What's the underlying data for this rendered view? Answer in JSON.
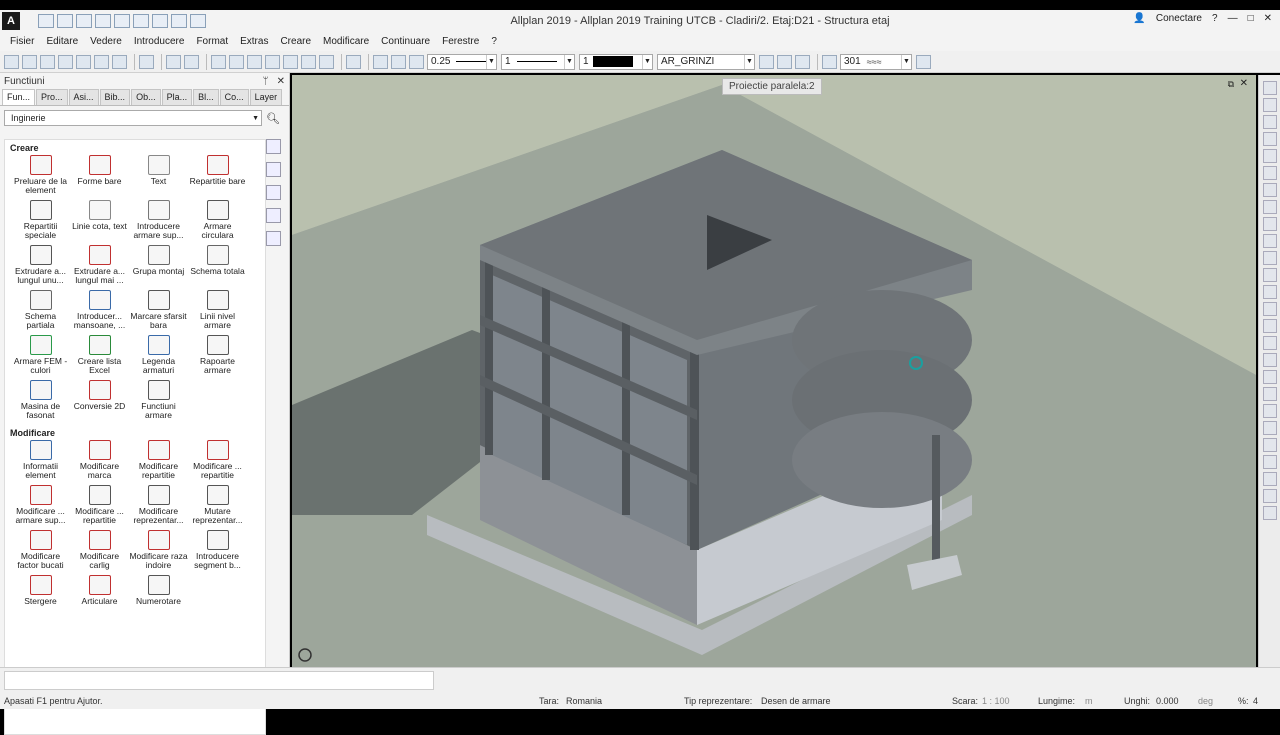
{
  "app": {
    "logo": "A",
    "title": "Allplan 2019 - Allplan 2019 Training UTCB - Cladiri/2. Etaj:D21 - Structura etaj",
    "connect": "Conectare",
    "help": "?",
    "minimize": "—",
    "maximize": "□",
    "close": "✕"
  },
  "menu": [
    "Fisier",
    "Editare",
    "Vedere",
    "Introducere",
    "Format",
    "Extras",
    "Creare",
    "Modificare",
    "Continuare",
    "Ferestre",
    "?"
  ],
  "toolbar": {
    "pen_value": "0.25",
    "line_value": "1",
    "color_value": "1",
    "layer_value": "AR_GRINZI",
    "hatch_value": "301"
  },
  "panel": {
    "title": "Functiuni",
    "pin": "ᛘ",
    "close": "✕",
    "tabs": [
      "Fun...",
      "Pro...",
      "Asi...",
      "Bib...",
      "Ob...",
      "Pla...",
      "Bl...",
      "Co...",
      "Layer"
    ],
    "category": "Inginerie",
    "sections": [
      {
        "title": "Creare",
        "items": [
          {
            "label": "Preluare de la element",
            "icon": "element-icon",
            "color": "#c03030"
          },
          {
            "label": "Forme bare",
            "icon": "rebar-shape-icon",
            "color": "#c03030"
          },
          {
            "label": "Text",
            "icon": "text-icon",
            "color": "#888888"
          },
          {
            "label": "Repartitie bare",
            "icon": "rebar-placement-icon",
            "color": "#c03030"
          },
          {
            "label": "Repartitii speciale",
            "icon": "special-placement-icon",
            "color": "#555555"
          },
          {
            "label": "Linie cota, text",
            "icon": "dimension-line-icon",
            "color": "#888888"
          },
          {
            "label": "Introducere armare sup...",
            "icon": "area-reinf-icon",
            "color": "#777777"
          },
          {
            "label": "Armare circulara",
            "icon": "circular-reinf-icon",
            "color": "#555555"
          },
          {
            "label": "Extrudare a... lungul unu...",
            "icon": "extrude-icon",
            "color": "#555555"
          },
          {
            "label": "Extrudare a... lungul mai ...",
            "icon": "extrude-multi-icon",
            "color": "#c03030"
          },
          {
            "label": "Grupa montaj",
            "icon": "group-icon",
            "color": "#666666"
          },
          {
            "label": "Schema totala",
            "icon": "schema-icon",
            "color": "#666666"
          },
          {
            "label": "Schema partiala",
            "icon": "partial-schema-icon",
            "color": "#666666"
          },
          {
            "label": "Introducer... mansoane, ...",
            "icon": "coupler-icon",
            "color": "#3a6aa8"
          },
          {
            "label": "Marcare sfarsit bara",
            "icon": "bar-end-icon",
            "color": "#555555"
          },
          {
            "label": "Linii nivel armare",
            "icon": "level-lines-icon",
            "color": "#555555"
          },
          {
            "label": "Armare FEM - culori",
            "icon": "fem-colors-icon",
            "color": "#2a9a4a"
          },
          {
            "label": "Creare lista Excel",
            "icon": "excel-icon",
            "color": "#2a8a3a"
          },
          {
            "label": "Legenda armaturi",
            "icon": "legend-icon",
            "color": "#3a6aa8"
          },
          {
            "label": "Rapoarte armare",
            "icon": "reports-icon",
            "color": "#555555"
          },
          {
            "label": "Masina de fasonat",
            "icon": "bending-machine-icon",
            "color": "#3a6aa8"
          },
          {
            "label": "Conversie 2D",
            "icon": "convert-2d-icon",
            "color": "#c03030"
          },
          {
            "label": "Functiuni armare",
            "icon": "reinf-functions-icon",
            "color": "#555555"
          }
        ]
      },
      {
        "title": "Modificare",
        "items": [
          {
            "label": "Informatii element",
            "icon": "info-icon",
            "color": "#3a6aa8"
          },
          {
            "label": "Modificare marca",
            "icon": "modify-mark-icon",
            "color": "#c03030"
          },
          {
            "label": "Modificare repartitie",
            "icon": "modify-placement-icon",
            "color": "#c03030"
          },
          {
            "label": "Modificare ... repartitie",
            "icon": "modify-placement2-icon",
            "color": "#c03030"
          },
          {
            "label": "Modificare ... armare sup...",
            "icon": "modify-area-icon",
            "color": "#c03030"
          },
          {
            "label": "Modificare ... repartitie",
            "icon": "modify-placement3-icon",
            "color": "#555555"
          },
          {
            "label": "Modificare reprezentar...",
            "icon": "modify-repr-icon",
            "color": "#555555"
          },
          {
            "label": "Mutare reprezentar...",
            "icon": "move-repr-icon",
            "color": "#555555"
          },
          {
            "label": "Modificare factor bucati",
            "icon": "modify-factor-icon",
            "color": "#c03030"
          },
          {
            "label": "Modificare carlig",
            "icon": "modify-hook-icon",
            "color": "#c03030"
          },
          {
            "label": "Modificare raza indoire",
            "icon": "modify-radius-icon",
            "color": "#c03030"
          },
          {
            "label": "Introducere segment b...",
            "icon": "insert-segment-icon",
            "color": "#555555"
          },
          {
            "label": "Stergere",
            "icon": "delete-icon",
            "color": "#c03030"
          },
          {
            "label": "Articulare",
            "icon": "joint-icon",
            "color": "#c03030"
          },
          {
            "label": "Numerotare",
            "icon": "numbering-icon",
            "color": "#555555"
          }
        ]
      }
    ]
  },
  "viewport": {
    "label": "Proiectie paralela:2"
  },
  "status": {
    "help": "Apasati F1 pentru Ajutor.",
    "country_label": "Tara:",
    "country": "Romania",
    "repr_label": "Tip reprezentare:",
    "repr": "Desen de armare",
    "scale_label": "Scara:",
    "scale": "1 : 100",
    "length_label": "Lungime:",
    "length_unit": "m",
    "angle_label": "Unghi:",
    "angle": "0.000",
    "angle_unit": "deg",
    "percent_label": "%:",
    "percent": "4"
  }
}
